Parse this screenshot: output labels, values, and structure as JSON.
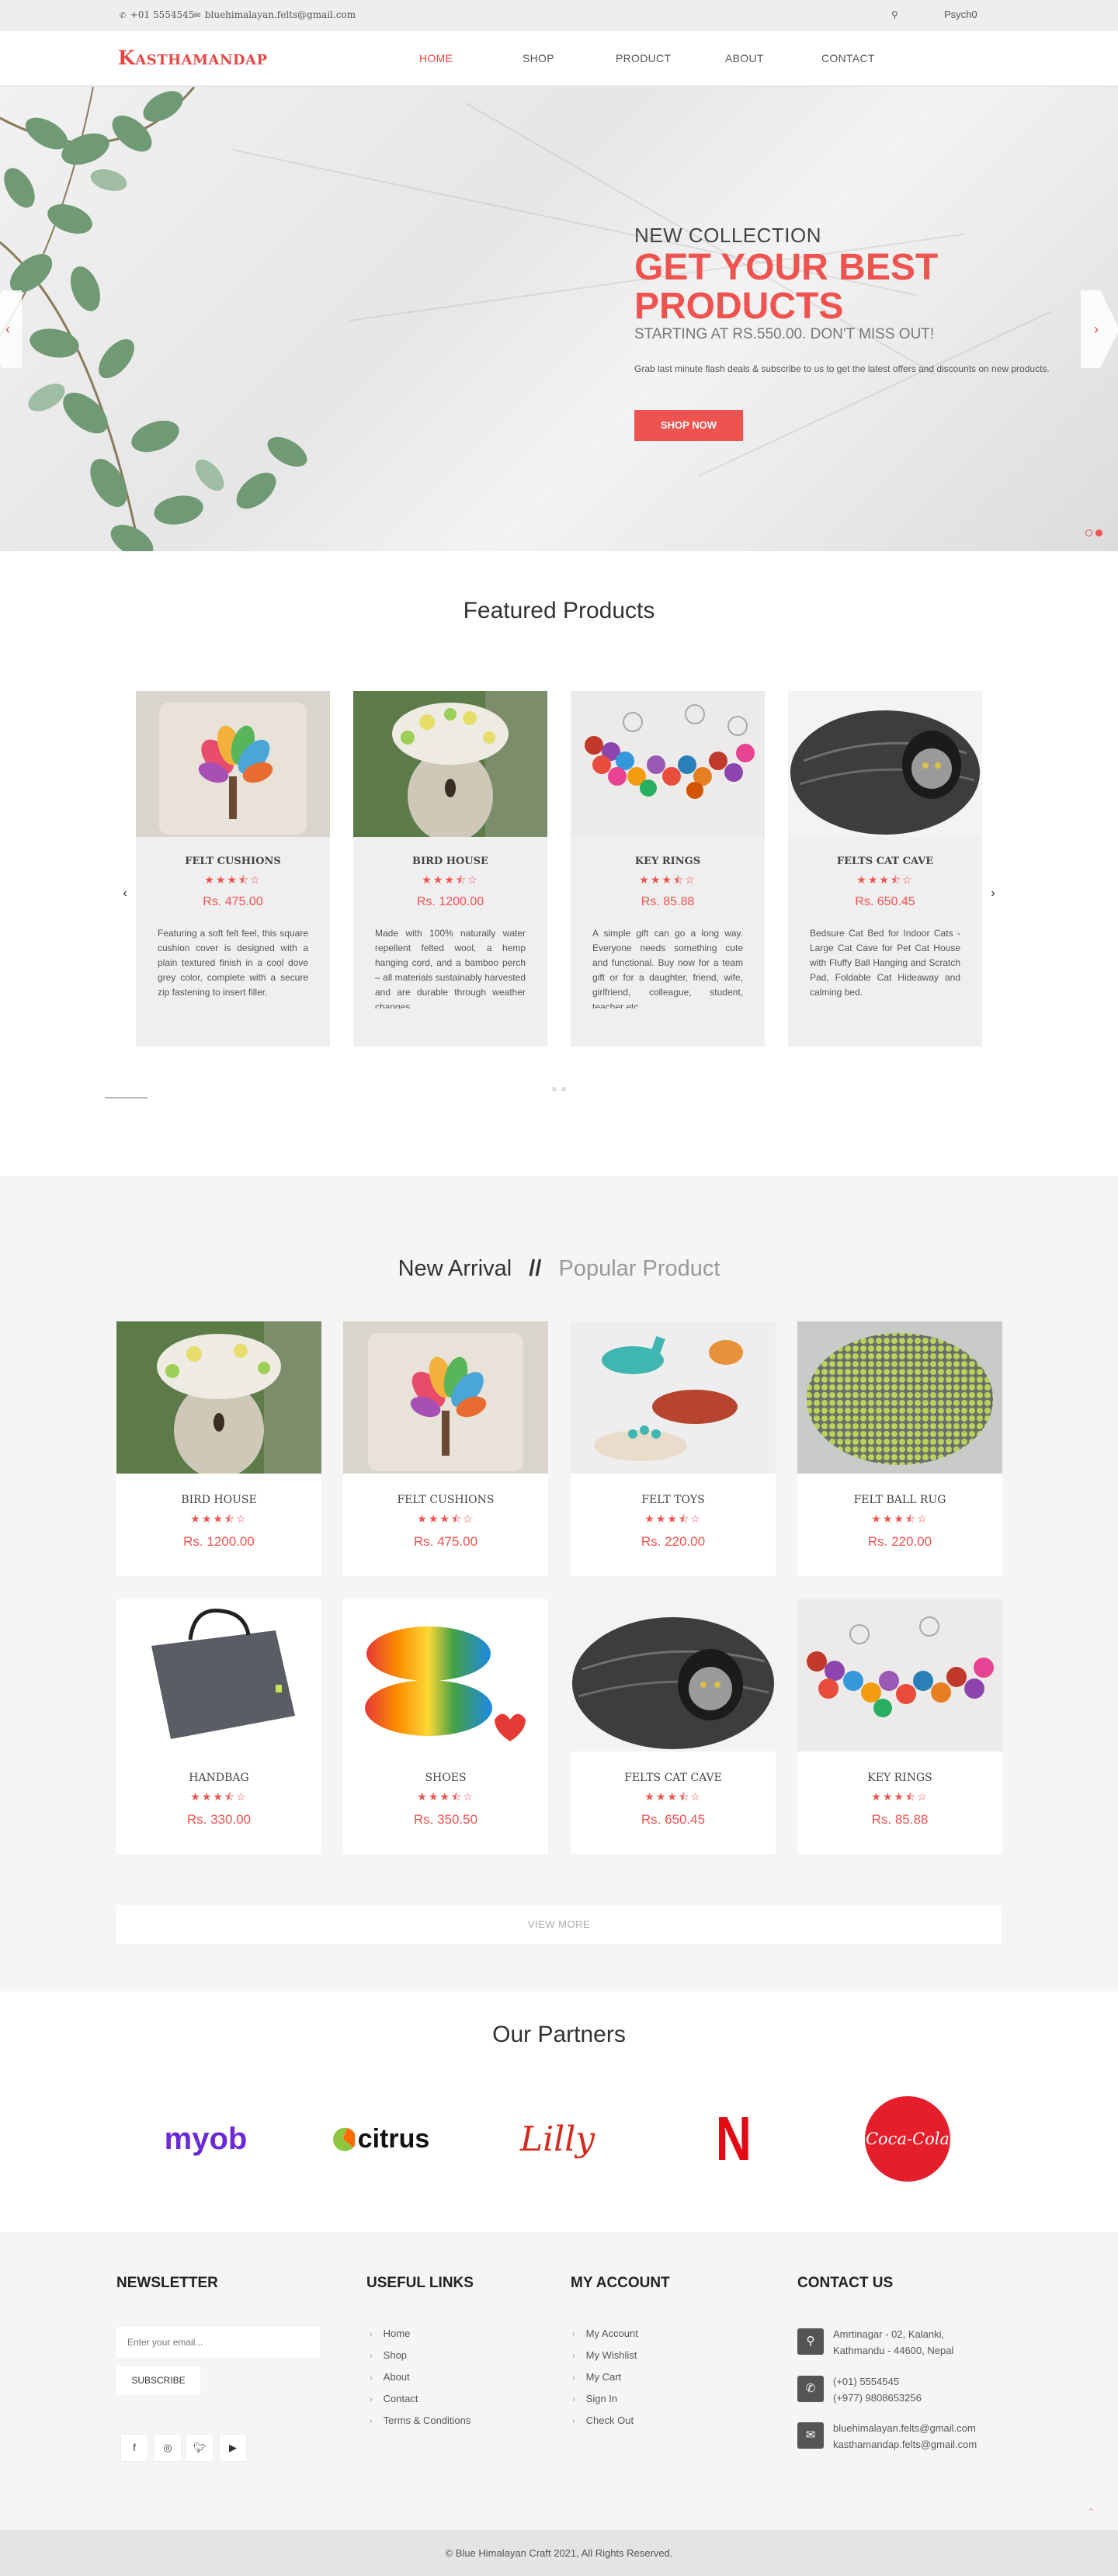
{
  "topbar": {
    "phone": "+01 5554545",
    "email": "bluehimalayan.felts@gmail.com",
    "user": "Psych0"
  },
  "nav": {
    "logo": "Kasthamandap",
    "links": [
      "HOME",
      "SHOP",
      "PRODUCT",
      "ABOUT",
      "CONTACT"
    ],
    "active": "HOME"
  },
  "hero": {
    "subtitle": "NEW COLLECTION",
    "title": "GET YOUR BEST PRODUCTS",
    "starting": "STARTING AT RS.550.00. DON'T MISS OUT!",
    "desc": "Grab last minute flash deals & subscribe to us to get the latest offers and discounts on new products.",
    "button": "SHOP NOW"
  },
  "featured": {
    "title": "Featured Products",
    "products": [
      {
        "name": "FELT CUSHIONS",
        "rating": 3.5,
        "stars": "★★★⯪☆",
        "price": "Rs. 475.00",
        "desc": "Featuring a soft felt feel, this square cushion cover is designed with a plain textured finish in a cool dove grey color, complete with a secure zip fastening to insert filler."
      },
      {
        "name": "BIRD HOUSE",
        "rating": 3.5,
        "stars": "★★★⯪☆",
        "price": "Rs. 1200.00",
        "desc": "Made with 100% naturally water repellent felted wool, a hemp hanging cord, and a bamboo perch – all materials sustainably harvested and are durable through weather changes."
      },
      {
        "name": "KEY RINGS",
        "rating": 3.5,
        "stars": "★★★⯪☆",
        "price": "Rs. 85.88",
        "desc": "A simple gift can go a long way. Everyone needs something cute and functional. Buy now for a team gift or for a daughter, friend, wife, girlfriend, colleague, student, teacher etc."
      },
      {
        "name": "FELTS CAT CAVE",
        "rating": 3.5,
        "stars": "★★★⯪☆",
        "price": "Rs. 650.45",
        "desc": "Bedsure Cat Bed for Indoor Cats -Large Cat Cave for Pet Cat House with Fluffy Ball Hanging and Scratch Pad, Foldable Cat Hideaway and calming bed."
      }
    ]
  },
  "arrival": {
    "title": "New Arrival",
    "separator": "//",
    "alt_title": "Popular Product",
    "products": [
      {
        "name": "BIRD HOUSE",
        "stars": "★★★⯪☆",
        "price": "Rs. 1200.00"
      },
      {
        "name": "FELT CUSHIONS",
        "stars": "★★★⯪☆",
        "price": "Rs. 475.00"
      },
      {
        "name": "FELT TOYS",
        "stars": "★★★⯪☆",
        "price": "Rs. 220.00"
      },
      {
        "name": "FELT BALL RUG",
        "stars": "★★★⯪☆",
        "price": "Rs. 220.00"
      },
      {
        "name": "HANDBAG",
        "stars": "★★★⯪☆",
        "price": "Rs. 330.00"
      },
      {
        "name": "SHOES",
        "stars": "★★★⯪☆",
        "price": "Rs. 350.50"
      },
      {
        "name": "FELTS CAT CAVE",
        "stars": "★★★⯪☆",
        "price": "Rs. 650.45"
      },
      {
        "name": "KEY RINGS",
        "stars": "★★★⯪☆",
        "price": "Rs. 85.88"
      }
    ],
    "view_more": "VIEW MORE"
  },
  "partners": {
    "title": "Our Partners",
    "names": [
      "myob",
      "citrus",
      "Lilly",
      "N",
      "Coca-Cola"
    ]
  },
  "footer": {
    "newsletter": {
      "title": "NEWSLETTER",
      "placeholder": "Enter your email...",
      "button": "SUBSCRIBE"
    },
    "useful": {
      "title": "USEFUL LINKS",
      "links": [
        "Home",
        "Shop",
        "About",
        "Contact",
        "Terms & Conditions"
      ]
    },
    "account": {
      "title": "MY ACCOUNT",
      "links": [
        "My Account",
        "My Wishlist",
        "My Cart",
        "Sign In",
        "Check Out"
      ]
    },
    "contact": {
      "title": "CONTACT US",
      "address": [
        "Amrtinagar - 02, Kalanki,",
        "Kathmandu - 44600, Nepal"
      ],
      "phones": [
        "(+01) 5554545",
        "(+977) 9808653256"
      ],
      "emails": [
        "bluehimalayan.felts@gmail.com",
        "kasthamandap.felts@gmail.com"
      ]
    },
    "copyright": "© Blue Himalayan Craft 2021, All Rights Reserved."
  },
  "colors": {
    "accent": "#ef5350",
    "bg_gray": "#f5f5f5"
  }
}
